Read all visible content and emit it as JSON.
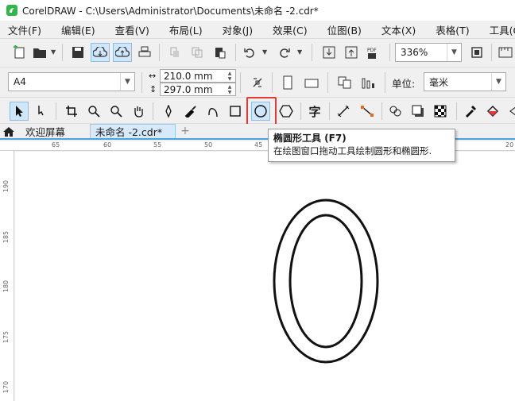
{
  "titlebar": {
    "title": "CorelDRAW - C:\\Users\\Administrator\\Documents\\未命名 -2.cdr*"
  },
  "menu": {
    "items": [
      "文件(F)",
      "编辑(E)",
      "查看(V)",
      "布局(L)",
      "对象(J)",
      "效果(C)",
      "位图(B)",
      "文本(X)",
      "表格(T)",
      "工具(O)"
    ]
  },
  "standard_toolbar": {
    "zoom_level": "336%"
  },
  "property_bar": {
    "page_size": "A4",
    "width": "210.0 mm",
    "height": "297.0 mm",
    "units_label": "单位:",
    "units_value": "毫米"
  },
  "toolbox": {
    "active_tool": "ellipse-tool",
    "text_tool_glyph": "字"
  },
  "tabs": {
    "welcome": "欢迎屏幕",
    "document": "未命名 -2.cdr*",
    "add": "+"
  },
  "rulers": {
    "horizontal": [
      "65",
      "60",
      "55",
      "50",
      "45",
      "20"
    ],
    "vertical": [
      "190",
      "185",
      "180",
      "175",
      "170"
    ]
  },
  "tooltip": {
    "title": "椭圆形工具 (F7)",
    "description": "在绘图窗口拖动工具绘制圆形和椭圆形."
  },
  "colors": {
    "accent": "#4aa3df",
    "highlight_border": "#e53935",
    "selected_tab": "#d6eafa",
    "logo": "#2fb84a"
  }
}
